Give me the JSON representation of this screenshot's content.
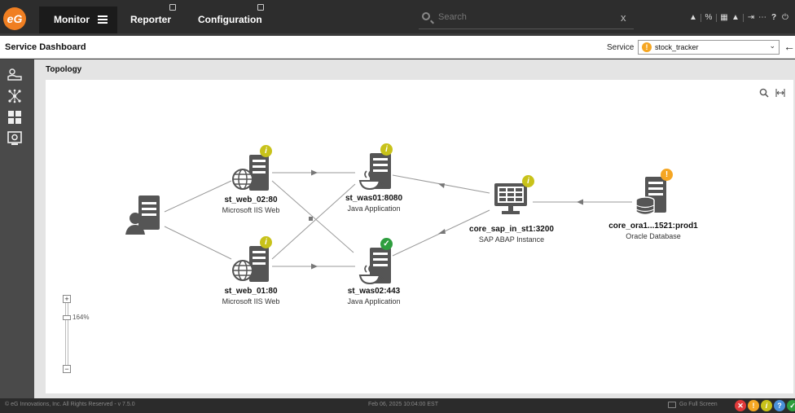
{
  "topbar": {
    "logo_text": "eG",
    "tabs": [
      {
        "label": "Monitor"
      },
      {
        "label": "Reporter"
      },
      {
        "label": "Configuration"
      }
    ],
    "search_placeholder": "Search",
    "search_clear": "x"
  },
  "header": {
    "title": "Service Dashboard",
    "service_label": "Service",
    "service_value": "stock_tracker"
  },
  "content": {
    "section_title": "Topology",
    "zoom_level": "164%",
    "zoom_fraction": 0.25
  },
  "topology": {
    "nodes": [
      {
        "name": "st_web_02:80",
        "type": "Microsoft IIS Web",
        "status": "info"
      },
      {
        "name": "st_web_01:80",
        "type": "Microsoft IIS Web",
        "status": "info"
      },
      {
        "name": "st_was01:8080",
        "type": "Java Application",
        "status": "info"
      },
      {
        "name": "st_was02:443",
        "type": "Java Application",
        "status": "ok"
      },
      {
        "name": "core_sap_in_st1:3200",
        "type": "SAP ABAP Instance",
        "status": "info"
      },
      {
        "name": "core_ora1...1521:prod1",
        "type": "Oracle Database",
        "status": "warning"
      }
    ]
  },
  "footer": {
    "copyright": "© eG Innovations, Inc. All Rights Reserved - v 7.5.0",
    "timestamp": "Feb 06, 2025 10:04:00 EST",
    "fullscreen": "Go Full Screen"
  },
  "colors": {
    "info": "#c8c21a",
    "ok": "#2e9e3e",
    "warning": "#f5a623",
    "critical": "#e03a3a",
    "unknown": "#4a90d9",
    "accent": "#f07f22"
  }
}
